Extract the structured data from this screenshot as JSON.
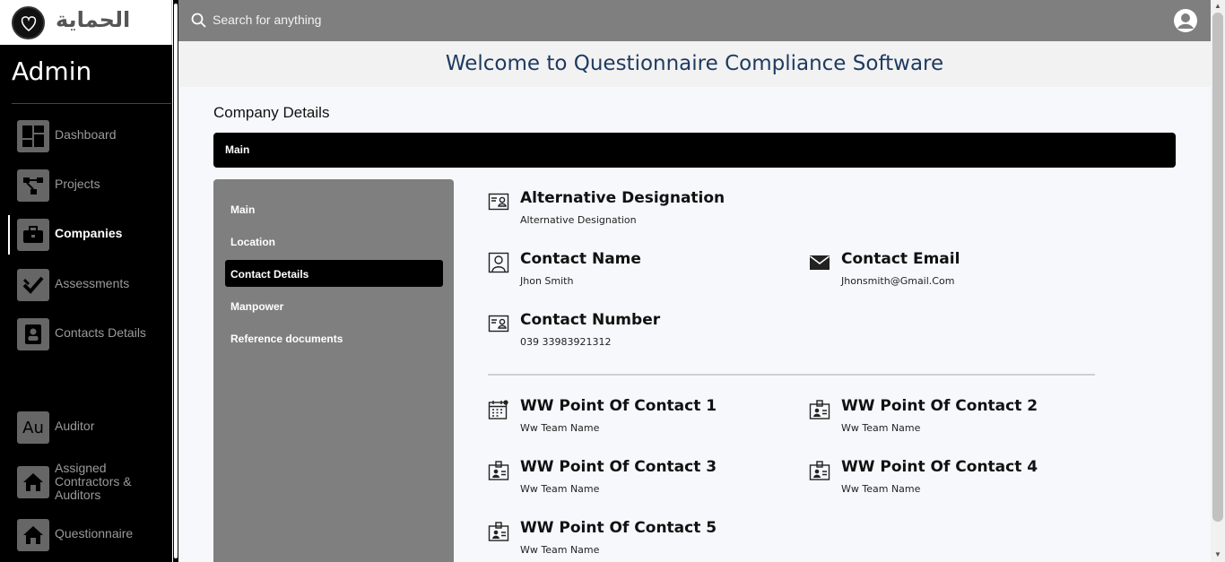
{
  "brand": {
    "logo_text": "الحماية"
  },
  "sidebar": {
    "role_title": "Admin",
    "items": [
      {
        "label": "Dashboard",
        "icon": "dashboard-icon",
        "active": false
      },
      {
        "label": "Projects",
        "icon": "projects-icon",
        "active": false
      },
      {
        "label": "Companies",
        "icon": "briefcase-icon",
        "active": true
      },
      {
        "label": "Assessments",
        "icon": "check-icon",
        "active": false
      },
      {
        "label": "Contacts Details",
        "icon": "contact-card-icon",
        "active": false
      },
      {
        "label": "Auditor",
        "icon": "auditor-icon",
        "icon_text": "Au",
        "active": false
      },
      {
        "label": "Assigned Contractors & Auditors",
        "icon": "home-icon",
        "active": false
      },
      {
        "label": "Questionnaire",
        "icon": "home-icon",
        "active": false
      }
    ]
  },
  "topbar": {
    "search_placeholder": "Search for anything",
    "profile_icon": "user-circle-icon"
  },
  "welcome": {
    "text": "Welcome to Questionnaire Compliance Software"
  },
  "company": {
    "section_title": "Company Details",
    "main_tab_label": "Main",
    "subnav": [
      {
        "label": "Main",
        "active": false
      },
      {
        "label": "Location",
        "active": false
      },
      {
        "label": "Contact Details",
        "active": true
      },
      {
        "label": "Manpower",
        "active": false
      },
      {
        "label": "Reference documents",
        "active": false
      }
    ],
    "fields": {
      "alt_designation": {
        "title": "Alternative Designation",
        "value": "Alternative Designation",
        "icon": "id-card-icon"
      },
      "contact_name": {
        "title": "Contact Name",
        "value": "Jhon Smith",
        "icon": "person-icon"
      },
      "contact_email": {
        "title": "Contact Email",
        "value": "Jhonsmith@Gmail.Com",
        "icon": "envelope-icon"
      },
      "contact_number": {
        "title": "Contact Number",
        "value": "039 33983921312",
        "icon": "id-card-icon"
      },
      "ww1": {
        "title": "WW Point Of Contact 1",
        "value": "Ww Team Name",
        "icon": "calendar-icon"
      },
      "ww2": {
        "title": "WW Point Of Contact 2",
        "value": "Ww Team Name",
        "icon": "badge-icon"
      },
      "ww3": {
        "title": "WW Point Of Contact 3",
        "value": "Ww Team Name",
        "icon": "badge-icon"
      },
      "ww4": {
        "title": "WW Point Of Contact 4",
        "value": "Ww Team Name",
        "icon": "badge-icon"
      },
      "ww5": {
        "title": "WW Point Of Contact 5",
        "value": "Ww Team Name",
        "icon": "badge-icon"
      }
    }
  },
  "colors": {
    "sidebar_bg": "#000000",
    "topbar_bg": "#7f7f7f",
    "welcome_text": "#1e3a5f",
    "subnav_bg": "#7f7f7f"
  }
}
